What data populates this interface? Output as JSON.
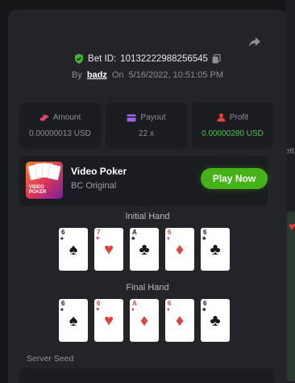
{
  "bet": {
    "label": "Bet ID:",
    "id": "10132222988256545",
    "by_label": "By",
    "user": "badz",
    "on_label": "On",
    "datetime": "5/16/2022, 10:51:05 PM"
  },
  "stats": {
    "amount": {
      "label": "Amount",
      "value": "0.00000013 USD"
    },
    "payout": {
      "label": "Payout",
      "value": "22 x"
    },
    "profit": {
      "label": "Profit",
      "value": "0.00000280 USD"
    }
  },
  "game": {
    "title": "Video Poker",
    "subtitle": "BC Original",
    "thumb_text_1": "VIDEO",
    "thumb_text_2": "POKER",
    "play_label": "Play Now"
  },
  "initial_hand": {
    "label": "Initial Hand",
    "cards": [
      {
        "rank": "6",
        "suit": "♠",
        "color": "black"
      },
      {
        "rank": "7",
        "suit": "♥",
        "color": "red"
      },
      {
        "rank": "A",
        "suit": "♣",
        "color": "black"
      },
      {
        "rank": "6",
        "suit": "♦",
        "color": "red"
      },
      {
        "rank": "6",
        "suit": "♣",
        "color": "black"
      }
    ]
  },
  "final_hand": {
    "label": "Final Hand",
    "cards": [
      {
        "rank": "6",
        "suit": "♠",
        "color": "black"
      },
      {
        "rank": "6",
        "suit": "♥",
        "color": "red"
      },
      {
        "rank": "A",
        "suit": "♦",
        "color": "red"
      },
      {
        "rank": "6",
        "suit": "♦",
        "color": "red"
      },
      {
        "rank": "6",
        "suit": "♣",
        "color": "black"
      }
    ]
  },
  "server_seed": {
    "label": "Server Seed"
  },
  "background": {
    "fragment_text": "ett"
  },
  "colors": {
    "accent_green": "#45b318",
    "profit_green": "#4cc14a",
    "heart_red": "#e2413c",
    "panel": "#232428"
  }
}
